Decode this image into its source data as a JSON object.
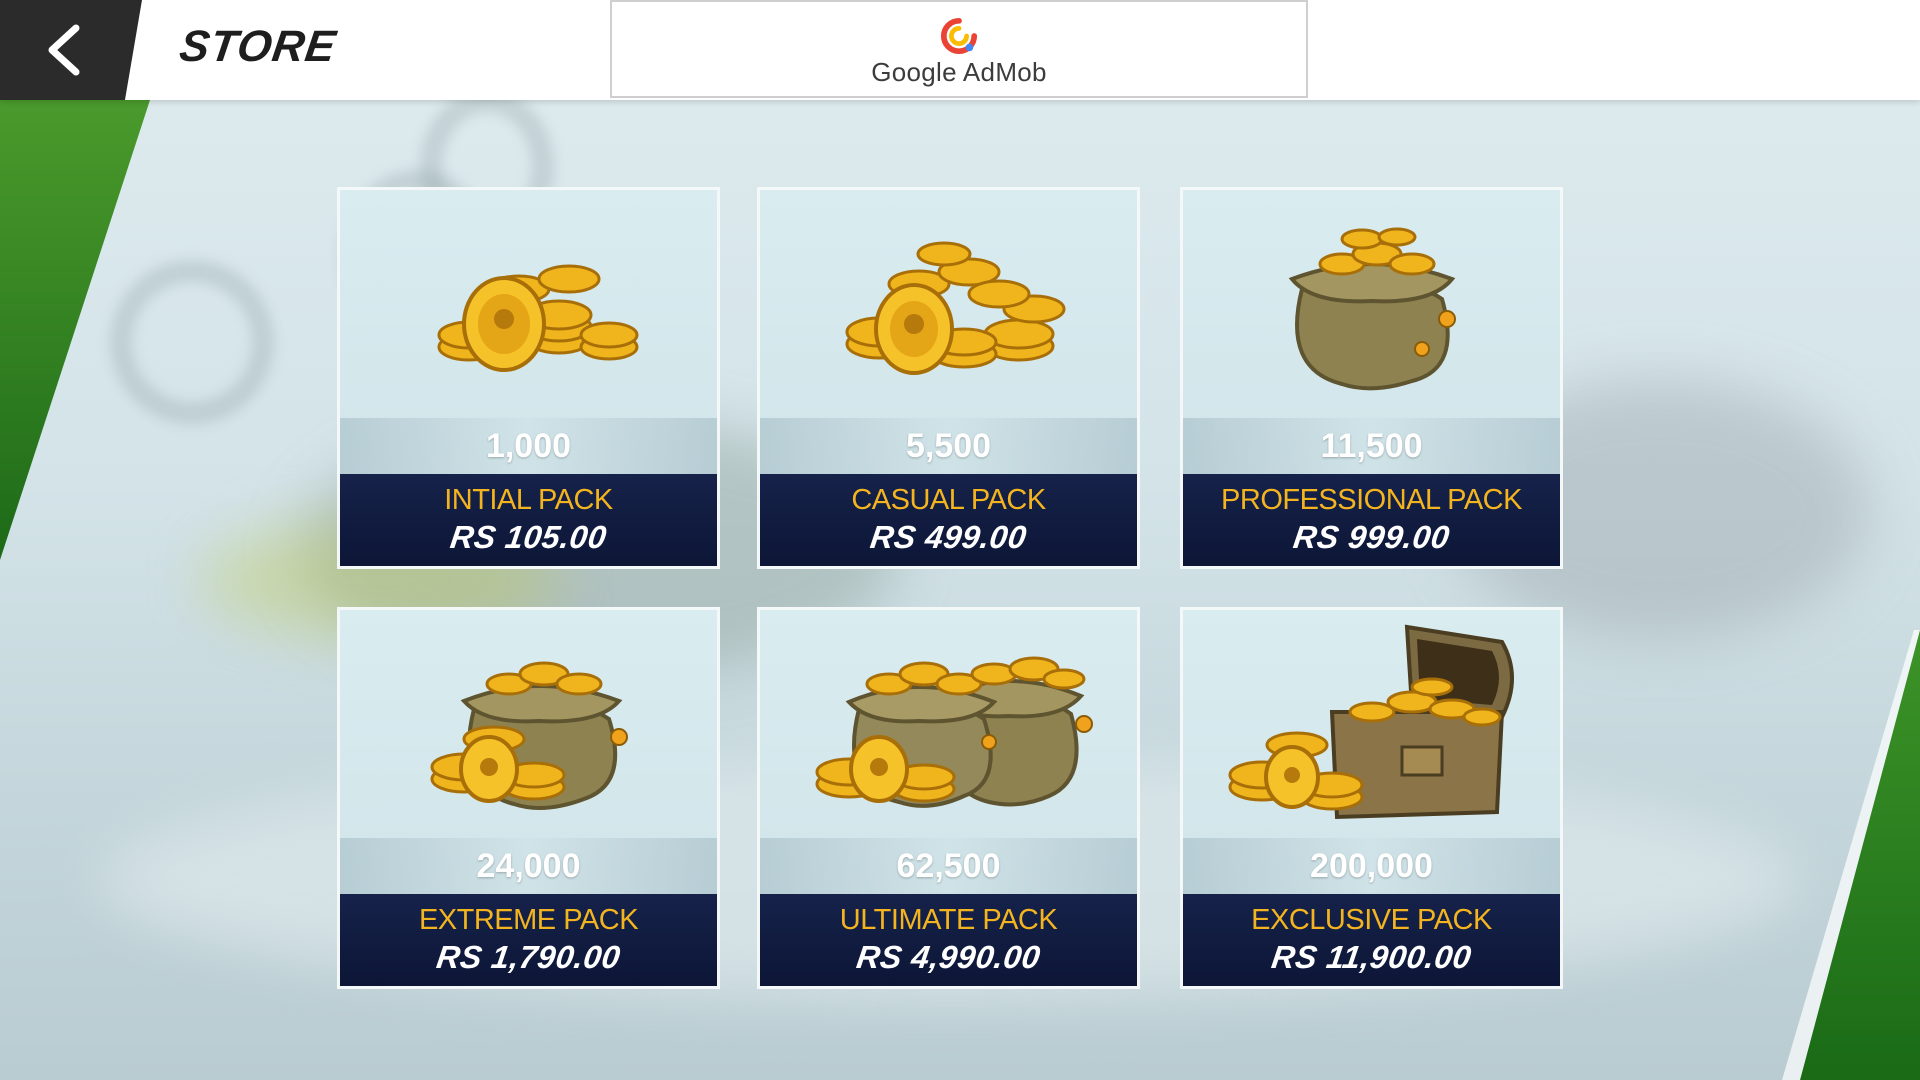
{
  "header": {
    "title": "STORE",
    "back_icon": "chevron-left-icon",
    "ad": {
      "brand_text": "Google AdMob",
      "logo_icon": "admob-logo"
    }
  },
  "colors": {
    "header_bg": "#ffffff",
    "back_button_bg": "#2b2b2b",
    "card_footer_bg": "#111c40",
    "pack_name_color": "#f3b41f",
    "accent_green": "#2f8a22"
  },
  "packs": [
    {
      "amount": "1,000",
      "name": "INTIAL PACK",
      "price": "RS 105.00",
      "art_icon": "coin-pile-small-icon"
    },
    {
      "amount": "5,500",
      "name": "CASUAL PACK",
      "price": "RS 499.00",
      "art_icon": "coin-pile-large-icon"
    },
    {
      "amount": "11,500",
      "name": "PROFESSIONAL PACK",
      "price": "RS 999.00",
      "art_icon": "coin-bag-icon"
    },
    {
      "amount": "24,000",
      "name": "EXTREME PACK",
      "price": "RS 1,790.00",
      "art_icon": "coin-bag-with-coins-icon"
    },
    {
      "amount": "62,500",
      "name": "ULTIMATE PACK",
      "price": "RS 4,990.00",
      "art_icon": "two-coin-bags-icon"
    },
    {
      "amount": "200,000",
      "name": "EXCLUSIVE PACK",
      "price": "RS 11,900.00",
      "art_icon": "treasure-chest-icon"
    }
  ]
}
